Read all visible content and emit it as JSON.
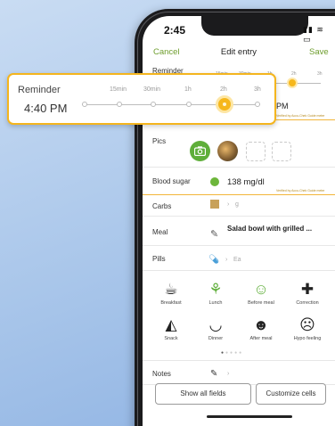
{
  "status_bar": {
    "time": "2:45",
    "icons": "▮▮ ≋ ▭"
  },
  "nav": {
    "cancel": "Cancel",
    "title": "Edit entry",
    "save": "Save"
  },
  "reminder_popup": {
    "label": "Reminder",
    "time": "4:40 PM",
    "scale": [
      "15min",
      "30min",
      "1h",
      "2h",
      "3h"
    ],
    "selected": "2h",
    "accent_color": "#f4b51e"
  },
  "reminder_row": {
    "label": "Reminder",
    "scale": [
      "15min",
      "30min",
      "1h",
      "2h",
      "3h"
    ],
    "time_fragment": "PM"
  },
  "verified_note": "Verified by Accu-Chek Guide meter",
  "pics": {
    "label": "Pics"
  },
  "blood_sugar": {
    "label": "Blood sugar",
    "value": "138 mg/dl",
    "verified_note": "Verified by Accu-Chek Guide meter"
  },
  "carbs": {
    "label": "Carbs",
    "unit": "g"
  },
  "meal": {
    "label": "Meal",
    "text": "Salad bowl with grilled ..."
  },
  "pills": {
    "label": "Pills",
    "unit": "Ea"
  },
  "tags": [
    {
      "label": "Breakfast",
      "icon": "coffee-icon"
    },
    {
      "label": "Lunch",
      "icon": "lunch-icon"
    },
    {
      "label": "Before meal",
      "icon": "before-meal-icon"
    },
    {
      "label": "Correction",
      "icon": "bandage-icon"
    },
    {
      "label": "Snack",
      "icon": "pizza-icon"
    },
    {
      "label": "Dinner",
      "icon": "bowl-icon"
    },
    {
      "label": "After meal",
      "icon": "after-meal-icon"
    },
    {
      "label": "Hypo feeling",
      "icon": "hypo-icon"
    }
  ],
  "page_dots": {
    "total": 5,
    "active": 1
  },
  "notes": {
    "label": "Notes"
  },
  "buttons": {
    "show_all": "Show all fields",
    "customize": "Customize cells"
  },
  "colors": {
    "accent_green": "#6e9d2d",
    "accent_yellow": "#f6b71c"
  }
}
